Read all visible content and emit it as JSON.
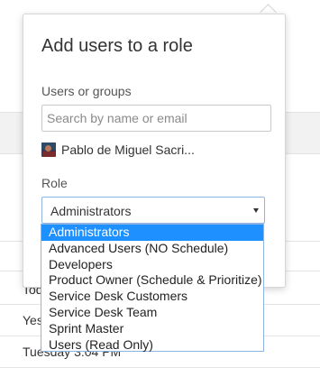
{
  "background": {
    "rows": [
      "Tod",
      "Yes",
      "Tuesday 3:04 PM"
    ]
  },
  "dialog": {
    "title": "Add users to a role",
    "users_label": "Users or groups",
    "search_placeholder": "Search by name or email",
    "selected_user": "Pablo de Miguel Sacri...",
    "role_label": "Role",
    "role_value": "Administrators",
    "role_options": [
      "Administrators",
      "Advanced Users (NO Schedule)",
      "Developers",
      "Product Owner (Schedule & Prioritize)",
      "Service Desk Customers",
      "Service Desk Team",
      "Sprint Master",
      "Users (Read Only)"
    ],
    "selected_option_index": 0
  },
  "colors": {
    "selected_option_bg": "#1e90ff",
    "select_border": "#8fb4df"
  }
}
